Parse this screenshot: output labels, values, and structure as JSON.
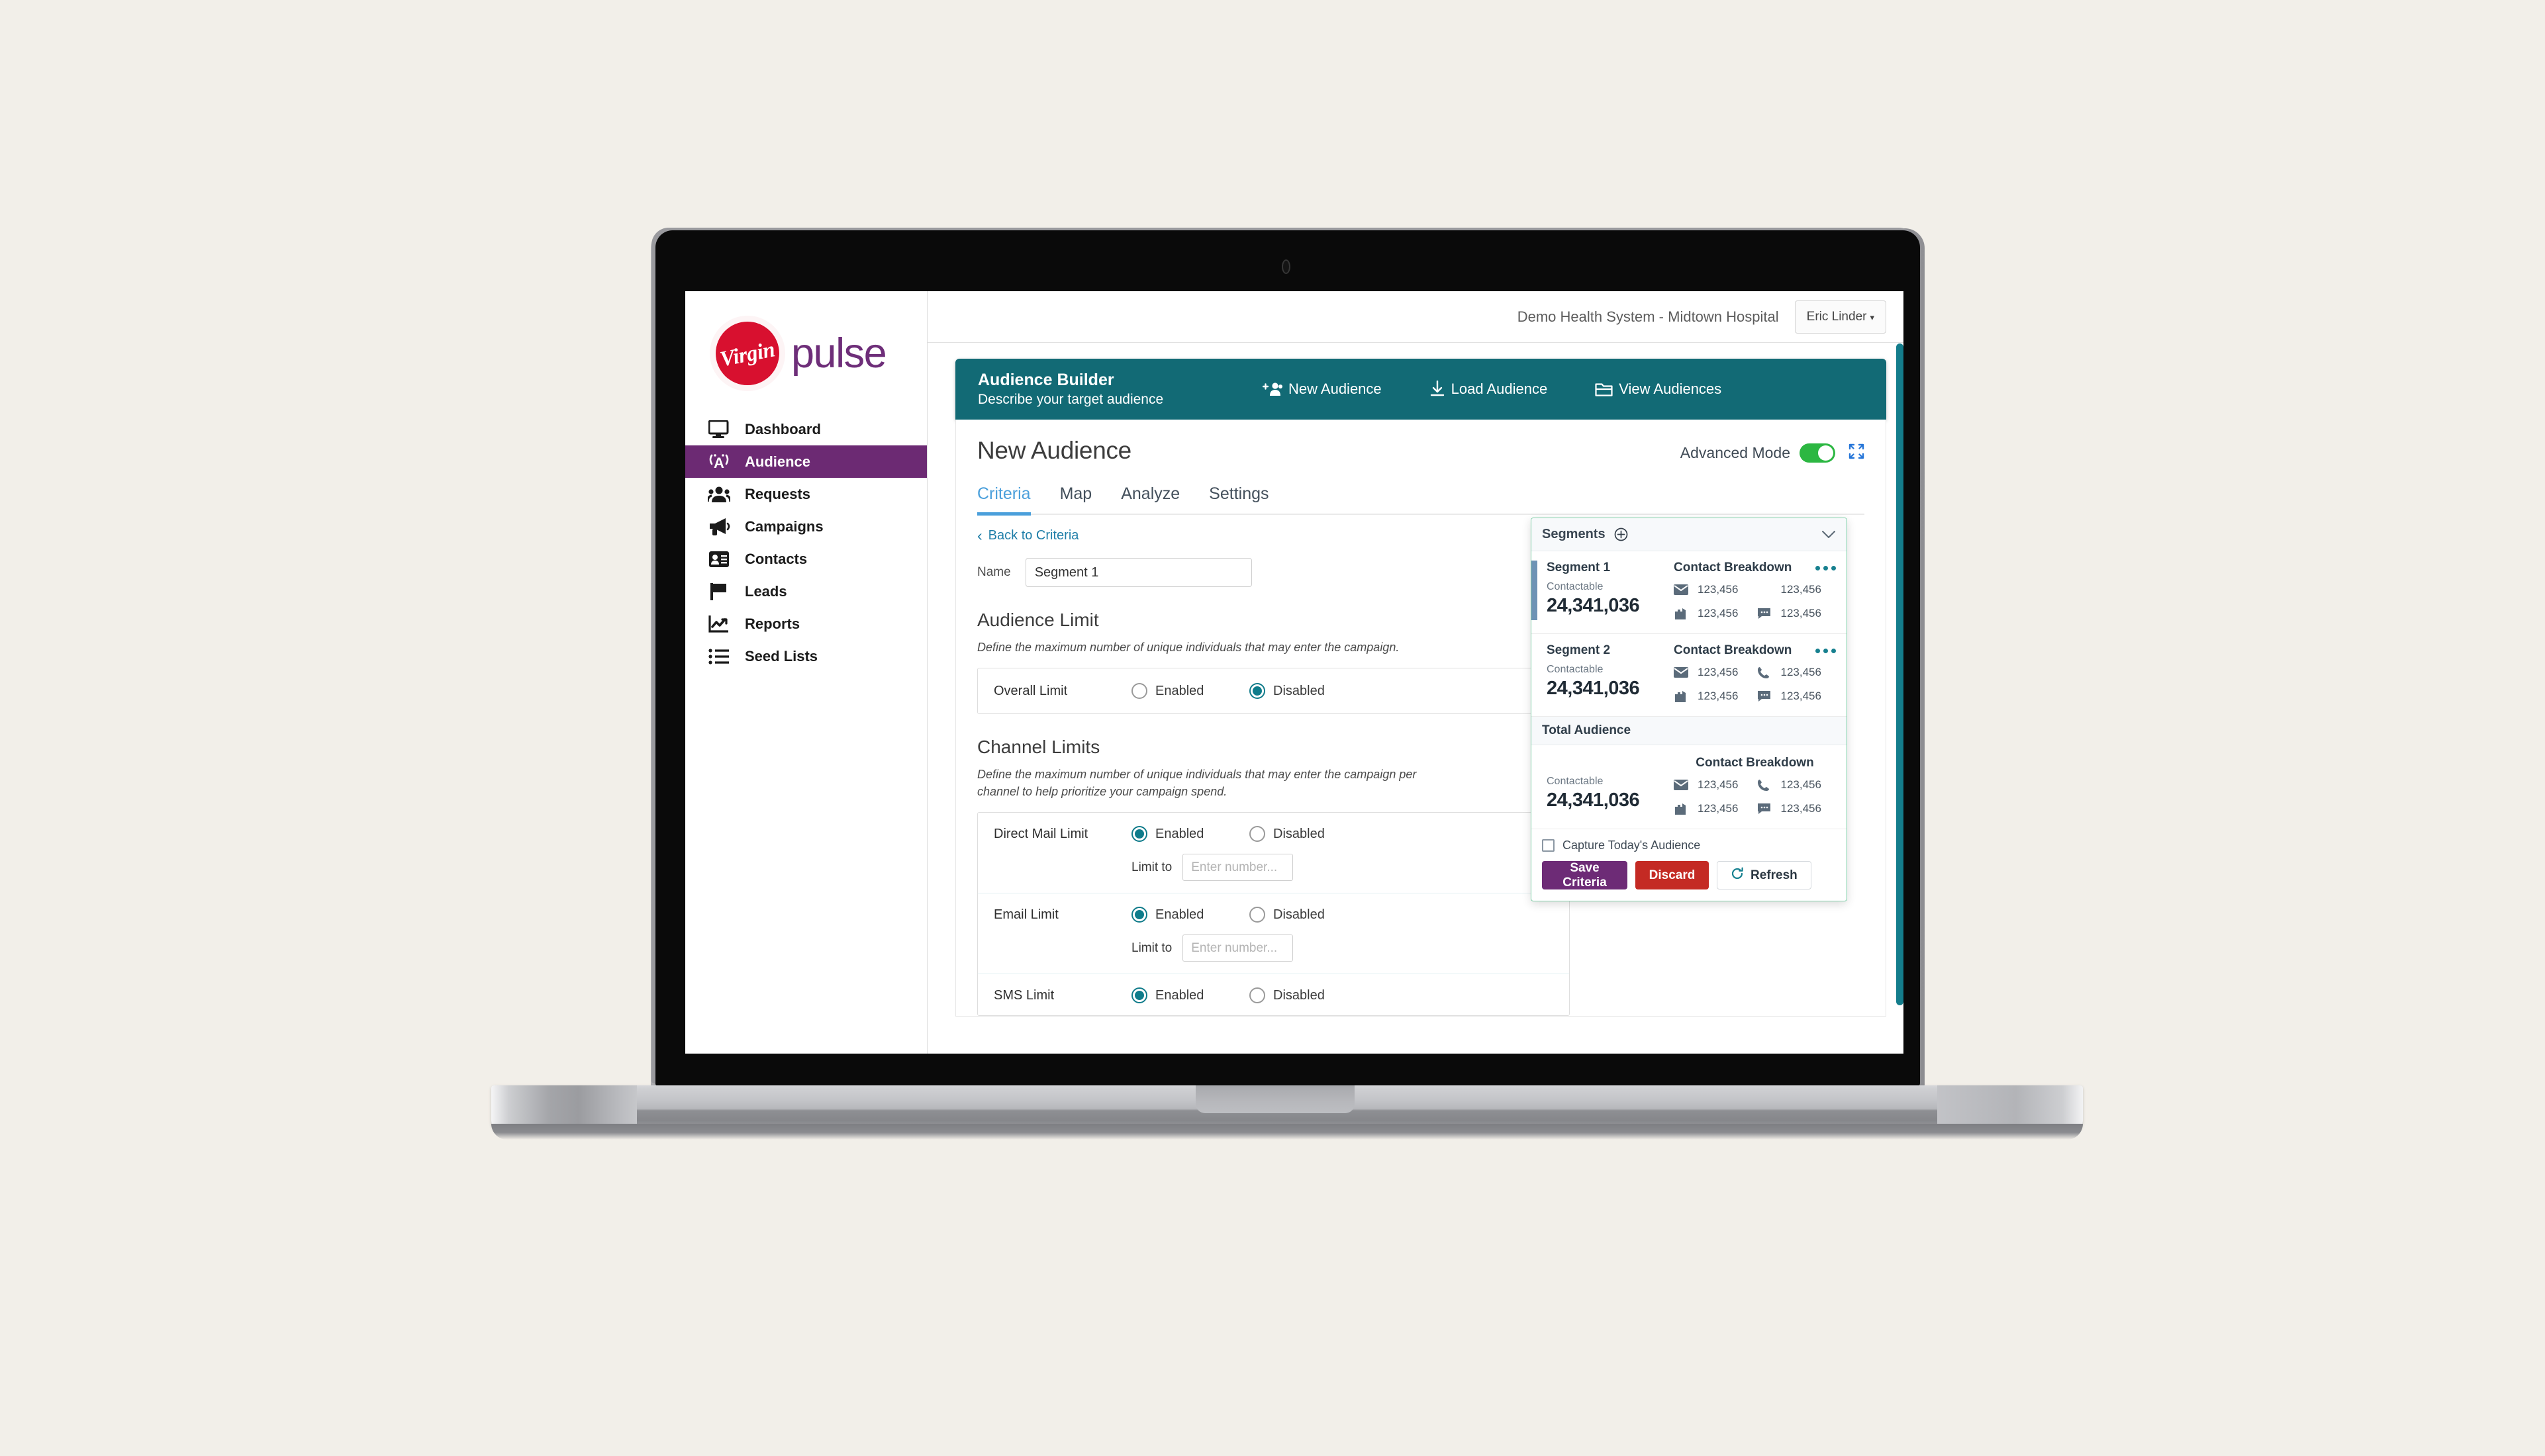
{
  "brand": {
    "circle_text": "Virgin",
    "word": "pulse",
    "circle_color": "#d8102f",
    "word_color": "#6e2e79"
  },
  "sidebar": {
    "items": [
      {
        "label": "Dashboard",
        "icon": "monitor-icon",
        "active": false
      },
      {
        "label": "Audience",
        "icon": "broadcast-icon",
        "active": true
      },
      {
        "label": "Requests",
        "icon": "people-icon",
        "active": false
      },
      {
        "label": "Campaigns",
        "icon": "megaphone-icon",
        "active": false
      },
      {
        "label": "Contacts",
        "icon": "contact-card-icon",
        "active": false
      },
      {
        "label": "Leads",
        "icon": "flag-icon",
        "active": false
      },
      {
        "label": "Reports",
        "icon": "chart-icon",
        "active": false
      },
      {
        "label": "Seed Lists",
        "icon": "list-icon",
        "active": false
      }
    ],
    "active_color": "#6c2a73"
  },
  "topbar": {
    "org": "Demo Health System - Midtown Hospital",
    "user": "Eric Linder",
    "caret": "▾"
  },
  "toolbar": {
    "title": "Audience Builder",
    "subtitle": "Describe your target audience",
    "color": "#126a75",
    "actions": [
      {
        "label": "New Audience",
        "icon": "add-user-icon"
      },
      {
        "label": "Load Audience",
        "icon": "download-icon"
      },
      {
        "label": "View Audiences",
        "icon": "folder-icon"
      }
    ]
  },
  "page": {
    "title": "New Audience",
    "advanced_mode_label": "Advanced Mode",
    "advanced_mode_on": true,
    "toggle_color": "#2cb742",
    "expand_icon": "expand-icon",
    "tabs": [
      {
        "label": "Criteria",
        "active": true
      },
      {
        "label": "Map",
        "active": false
      },
      {
        "label": "Analyze",
        "active": false
      },
      {
        "label": "Settings",
        "active": false
      }
    ],
    "tab_accent": "#4a9fdb",
    "back_link": "Back to Criteria"
  },
  "form": {
    "name_label": "Name",
    "name_value": "Segment 1",
    "audience_limit": {
      "heading": "Audience Limit",
      "description": "Define the maximum number of unique individuals that may enter the campaign.",
      "row_label": "Overall Limit",
      "enabled_label": "Enabled",
      "disabled_label": "Disabled",
      "selected": "Disabled"
    },
    "channel_limits": {
      "heading": "Channel Limits",
      "description": "Define the maximum number of unique individuals that may enter the campaign per channel to help prioritize your campaign spend.",
      "limit_to_label": "Limit to",
      "limit_placeholder": "Enter number...",
      "enabled_label": "Enabled",
      "disabled_label": "Disabled",
      "channels": [
        {
          "label": "Direct Mail Limit",
          "selected": "Enabled",
          "limit_value": "",
          "has_limit_input": true
        },
        {
          "label": "Email Limit",
          "selected": "Enabled",
          "limit_value": "",
          "has_limit_input": true
        },
        {
          "label": "SMS Limit",
          "selected": "Enabled",
          "limit_value": "",
          "has_limit_input": false
        }
      ]
    }
  },
  "segments_panel": {
    "header_title": "Segments",
    "add_icon": "plus-circle-icon",
    "collapse_icon": "chevron-down-icon",
    "contact_breakdown_label": "Contact Breakdown",
    "contactable_label": "Contactable",
    "total_audience_label": "Total Audience",
    "border_color": "#7fd0a8",
    "accent_color": "#6e93b5",
    "segments": [
      {
        "name": "Segment 1",
        "contactable": "24,341,036",
        "accent": true,
        "breakdown": [
          {
            "icon": "envelope-icon",
            "value": "123,456"
          },
          {
            "icon": "none",
            "value": "123,456"
          },
          {
            "icon": "mailbox-icon",
            "value": "123,456"
          },
          {
            "icon": "sms-icon",
            "value": "123,456"
          }
        ]
      },
      {
        "name": "Segment 2",
        "contactable": "24,341,036",
        "accent": false,
        "breakdown": [
          {
            "icon": "envelope-icon",
            "value": "123,456"
          },
          {
            "icon": "phone-icon",
            "value": "123,456"
          },
          {
            "icon": "mailbox-icon",
            "value": "123,456"
          },
          {
            "icon": "sms-icon",
            "value": "123,456"
          }
        ]
      }
    ],
    "total": {
      "contactable": "24,341,036",
      "breakdown": [
        {
          "icon": "envelope-icon",
          "value": "123,456"
        },
        {
          "icon": "phone-icon",
          "value": "123,456"
        },
        {
          "icon": "mailbox-icon",
          "value": "123,456"
        },
        {
          "icon": "sms-icon",
          "value": "123,456"
        }
      ]
    },
    "capture_label": "Capture Today's Audience",
    "capture_checked": false,
    "buttons": {
      "save": "Save Criteria",
      "discard": "Discard",
      "refresh": "Refresh",
      "save_color": "#6d2b76",
      "discard_color": "#c42a24"
    }
  },
  "scrollbar_color": "#147d8c"
}
